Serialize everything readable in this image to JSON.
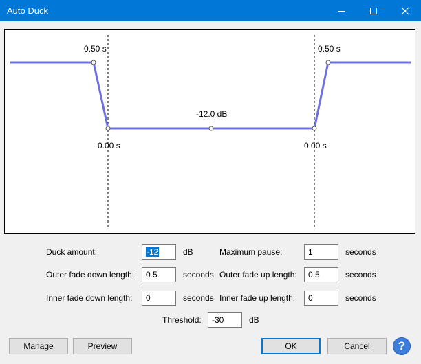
{
  "window": {
    "title": "Auto Duck"
  },
  "graph": {
    "outer_fade_down_label": "0.50 s",
    "outer_fade_up_label": "0.50 s",
    "inner_fade_down_label": "0.00 s",
    "inner_fade_up_label": "0.00 s",
    "duck_amount_label": "-12.0 dB"
  },
  "form": {
    "duck_amount": {
      "label": "Duck amount:",
      "value": "-12",
      "unit": "dB"
    },
    "maximum_pause": {
      "label": "Maximum pause:",
      "value": "1",
      "unit": "seconds"
    },
    "outer_fade_down": {
      "label": "Outer fade down length:",
      "value": "0.5",
      "unit": "seconds"
    },
    "outer_fade_up": {
      "label": "Outer fade up length:",
      "value": "0.5",
      "unit": "seconds"
    },
    "inner_fade_down": {
      "label": "Inner fade down length:",
      "value": "0",
      "unit": "seconds"
    },
    "inner_fade_up": {
      "label": "Inner fade up length:",
      "value": "0",
      "unit": "seconds"
    },
    "threshold": {
      "label": "Threshold:",
      "value": "-30",
      "unit": "dB"
    }
  },
  "buttons": {
    "manage_hotkey": "M",
    "manage_rest": "anage",
    "preview_hotkey": "P",
    "preview_rest": "review",
    "ok": "OK",
    "cancel": "Cancel",
    "help": "?"
  },
  "colors": {
    "titlebar": "#0078d7",
    "envelope": "#7070e0"
  },
  "icons": [
    "minimize-icon",
    "maximize-icon",
    "close-icon",
    "help-icon"
  ]
}
